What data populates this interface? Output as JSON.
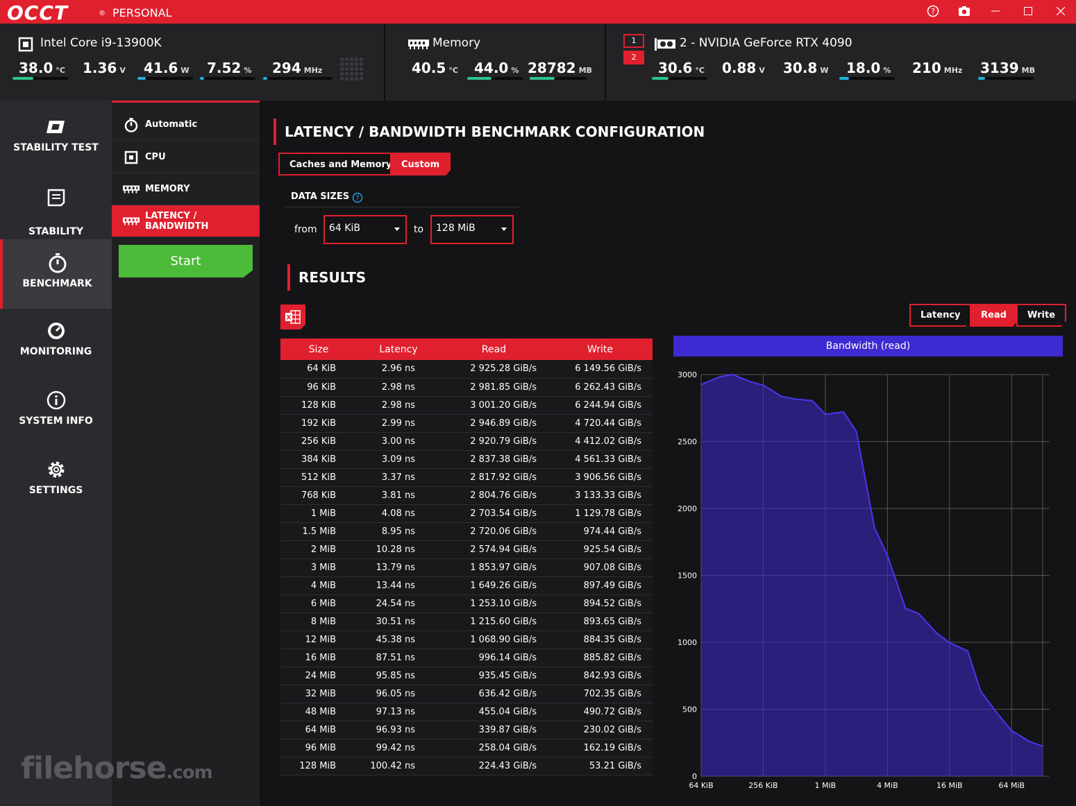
{
  "app": {
    "logo": "OCCT",
    "registered": "®",
    "edition": "PERSONAL"
  },
  "titlebar_icons": [
    "help-icon",
    "camera-icon",
    "minimize-icon",
    "maximize-icon",
    "close-icon"
  ],
  "cpu": {
    "name": "Intel Core i9-13900K",
    "metrics": [
      {
        "value": "38.0",
        "unit": "°C",
        "level": 0.38
      },
      {
        "value": "1.36",
        "unit": "V",
        "level": null
      },
      {
        "value": "41.6",
        "unit": "W",
        "level": 0.15
      },
      {
        "value": "7.52",
        "unit": "%",
        "level": 0.08
      },
      {
        "value": "294",
        "unit": "MHz",
        "level": 0.06
      }
    ]
  },
  "memory": {
    "name": "Memory",
    "metrics": [
      {
        "value": "40.5",
        "unit": "°C",
        "level": null
      },
      {
        "value": "44.0",
        "unit": "%",
        "level": 0.44
      },
      {
        "value": "28782",
        "unit": "MB",
        "level": 0.44
      }
    ]
  },
  "gpu": {
    "selector": [
      "1",
      "2"
    ],
    "name": "2 - NVIDIA GeForce RTX 4090",
    "metrics": [
      {
        "value": "30.6",
        "unit": "°C",
        "level": 0.3
      },
      {
        "value": "0.88",
        "unit": "V",
        "level": null
      },
      {
        "value": "30.8",
        "unit": "W",
        "level": null
      },
      {
        "value": "18.0",
        "unit": "%",
        "level": 0.18
      },
      {
        "value": "210",
        "unit": "MHz",
        "level": null
      },
      {
        "value": "3139",
        "unit": "MB",
        "level": 0.12
      }
    ]
  },
  "sidebar": {
    "items": [
      {
        "label": "STABILITY TEST",
        "icon": "occt-logo-icon"
      },
      {
        "label": "STABILITY\nCERTIFICATE",
        "icon": "certificate-icon"
      },
      {
        "label": "BENCHMARK",
        "icon": "stopwatch-icon",
        "active": true
      },
      {
        "label": "MONITORING",
        "icon": "gauge-icon"
      },
      {
        "label": "SYSTEM INFO",
        "icon": "info-icon"
      },
      {
        "label": "SETTINGS",
        "icon": "gear-icon"
      }
    ]
  },
  "submenu": {
    "items": [
      {
        "label": "Automatic",
        "icon": "stopwatch-icon"
      },
      {
        "label": "CPU",
        "icon": "cpu-icon"
      },
      {
        "label": "MEMORY",
        "icon": "memory-icon"
      },
      {
        "label": "LATENCY / BANDWIDTH",
        "icon": "memory-icon",
        "active": true
      }
    ],
    "start_label": "Start"
  },
  "config": {
    "title": "LATENCY / BANDWIDTH BENCHMARK CONFIGURATION",
    "tabs": [
      {
        "label": "Caches and Memory"
      },
      {
        "label": "Custom",
        "active": true
      }
    ],
    "data_sizes_label": "DATA SIZES",
    "from_label": "from",
    "from_value": "64 KiB",
    "to_label": "to",
    "to_value": "128 MiB"
  },
  "results": {
    "title": "RESULTS",
    "graph_buttons": [
      {
        "label": "Latency"
      },
      {
        "label": "Read",
        "active": true
      },
      {
        "label": "Write"
      }
    ],
    "columns": [
      "Size",
      "Latency",
      "Read",
      "Write"
    ],
    "rows": [
      [
        "64 KiB",
        "2.96 ns",
        "2 925.28 GiB/s",
        "6 149.56 GiB/s"
      ],
      [
        "96 KiB",
        "2.98 ns",
        "2 981.85 GiB/s",
        "6 262.43 GiB/s"
      ],
      [
        "128 KiB",
        "2.98 ns",
        "3 001.20 GiB/s",
        "6 244.94 GiB/s"
      ],
      [
        "192 KiB",
        "2.99 ns",
        "2 946.89 GiB/s",
        "4 720.44 GiB/s"
      ],
      [
        "256 KiB",
        "3.00 ns",
        "2 920.79 GiB/s",
        "4 412.02 GiB/s"
      ],
      [
        "384 KiB",
        "3.09 ns",
        "2 837.38 GiB/s",
        "4 561.33 GiB/s"
      ],
      [
        "512 KiB",
        "3.37 ns",
        "2 817.92 GiB/s",
        "3 906.56 GiB/s"
      ],
      [
        "768 KiB",
        "3.81 ns",
        "2 804.76 GiB/s",
        "3 133.33 GiB/s"
      ],
      [
        "1 MiB",
        "4.08 ns",
        "2 703.54 GiB/s",
        "1 129.78 GiB/s"
      ],
      [
        "1.5 MiB",
        "8.95 ns",
        "2 720.06 GiB/s",
        "974.44 GiB/s"
      ],
      [
        "2 MiB",
        "10.28 ns",
        "2 574.94 GiB/s",
        "925.54 GiB/s"
      ],
      [
        "3 MiB",
        "13.79 ns",
        "1 853.97 GiB/s",
        "907.08 GiB/s"
      ],
      [
        "4 MiB",
        "13.44 ns",
        "1 649.26 GiB/s",
        "897.49 GiB/s"
      ],
      [
        "6 MiB",
        "24.54 ns",
        "1 253.10 GiB/s",
        "894.52 GiB/s"
      ],
      [
        "8 MiB",
        "30.51 ns",
        "1 215.60 GiB/s",
        "893.65 GiB/s"
      ],
      [
        "12 MiB",
        "45.38 ns",
        "1 068.90 GiB/s",
        "884.35 GiB/s"
      ],
      [
        "16 MiB",
        "87.51 ns",
        "996.14 GiB/s",
        "885.82 GiB/s"
      ],
      [
        "24 MiB",
        "95.85 ns",
        "935.45 GiB/s",
        "842.93 GiB/s"
      ],
      [
        "32 MiB",
        "96.05 ns",
        "636.42 GiB/s",
        "702.35 GiB/s"
      ],
      [
        "48 MiB",
        "97.13 ns",
        "455.04 GiB/s",
        "490.72 GiB/s"
      ],
      [
        "64 MiB",
        "96.93 ns",
        "339.87 GiB/s",
        "230.02 GiB/s"
      ],
      [
        "96 MiB",
        "99.42 ns",
        "258.04 GiB/s",
        "162.19 GiB/s"
      ],
      [
        "128 MiB",
        "100.42 ns",
        "224.43 GiB/s",
        "53.21 GiB/s"
      ]
    ]
  },
  "chart_data": {
    "type": "area",
    "title": "Bandwidth (read)",
    "x": [
      "64 KiB",
      "96 KiB",
      "128 KiB",
      "192 KiB",
      "256 KiB",
      "384 KiB",
      "512 KiB",
      "768 KiB",
      "1 MiB",
      "1.5 MiB",
      "2 MiB",
      "3 MiB",
      "4 MiB",
      "6 MiB",
      "8 MiB",
      "12 MiB",
      "16 MiB",
      "24 MiB",
      "32 MiB",
      "48 MiB",
      "64 MiB",
      "96 MiB",
      "128 MiB"
    ],
    "x_tick_labels": [
      "64 KiB",
      "256 KiB",
      "1 MiB",
      "4 MiB",
      "16 MiB",
      "64 MiB"
    ],
    "x_scale": "log2",
    "values": [
      2925.28,
      2981.85,
      3001.2,
      2946.89,
      2920.79,
      2837.38,
      2817.92,
      2804.76,
      2703.54,
      2720.06,
      2574.94,
      1853.97,
      1649.26,
      1253.1,
      1215.6,
      1068.9,
      996.14,
      935.45,
      636.42,
      455.04,
      339.87,
      258.04,
      224.43
    ],
    "y_ticks": [
      0,
      500,
      1000,
      1500,
      2000,
      2500,
      3000
    ],
    "ylim": [
      0,
      3000
    ],
    "grid": true,
    "color": "#3d2ad0"
  },
  "watermark": {
    "text": "filehorse",
    "suffix": ".com"
  },
  "colors": {
    "accent": "#e0202e",
    "start": "#4dbb3a",
    "bar_fill": "#2bc48a",
    "bar_fill_alt": "#20b0d8",
    "chart": "#3d2ad0"
  }
}
